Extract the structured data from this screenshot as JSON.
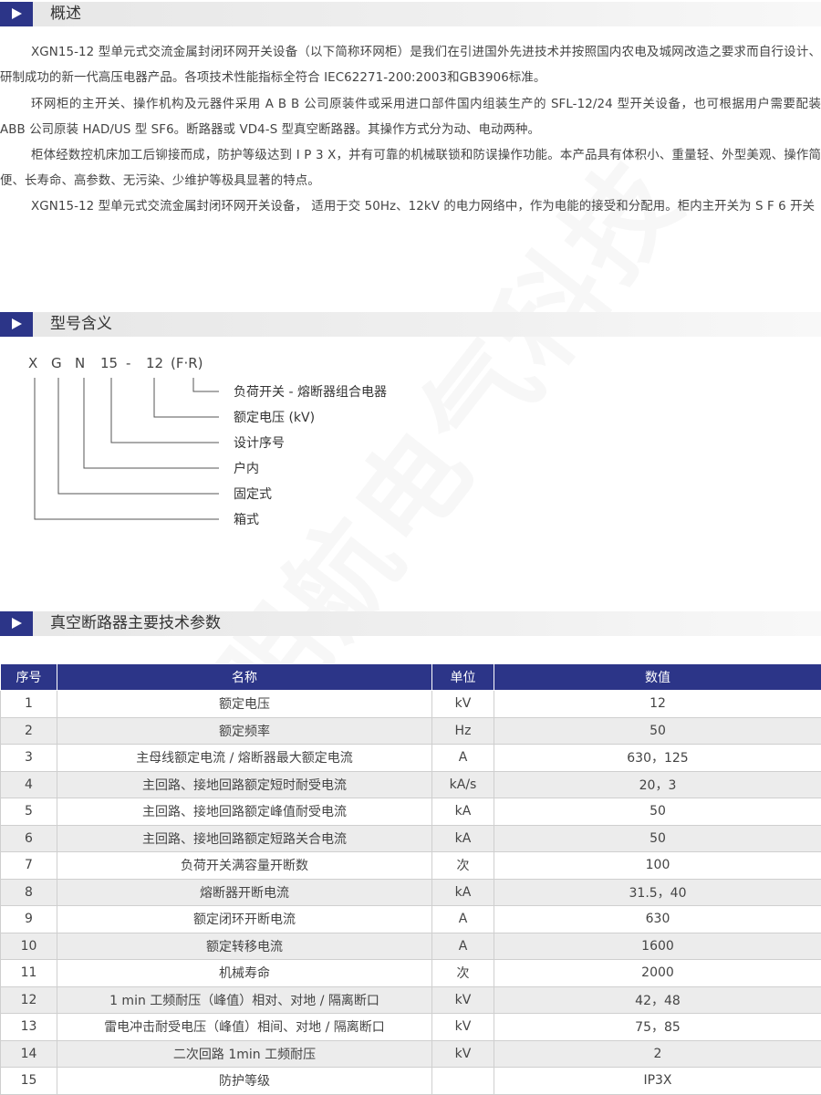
{
  "sections": {
    "overview": "概述",
    "model": "型号含义",
    "params": "真空断路器主要技术参数"
  },
  "overview_paragraphs": [
    "XGN15-12 型单元式交流金属封闭环网开关设备（以下简称环网柜）是我们在引进国外先进技术并按照国内农电及城网改造之要求而自行设计、研制成功的新一代高压电器产品。各项技术性能指标全符合 IEC62271-200:2003和GB3906标准。",
    "环网柜的主开关、操作机构及元器件采用 A B B 公司原装件或采用进口部件国内组装生产的 SFL-12/24 型开关设备，也可根据用户需要配装 ABB 公司原装 HAD/US 型 SF6。断路器或 VD4-S 型真空断路器。其操作方式分为动、电动两种。",
    "柜体经数控机床加工后铆接而成，防护等级达到 I P 3 X，并有可靠的机械联锁和防误操作功能。本产品具有体积小、重量轻、外型美观、操作简便、长寿命、高参数、无污染、少维护等极具显著的特点。",
    "XGN15-12 型单元式交流金属封闭环网开关设备， 适用于交 50Hz、12kV 的电力网络中，作为电能的接受和分配用。柜内主开关为 S F 6 开关"
  ],
  "model_code": {
    "parts": [
      "X",
      "G",
      "N",
      "15",
      "-",
      "12",
      "(F·R)"
    ]
  },
  "model_meanings": [
    "负荷开关 - 熔断器组合电器",
    "额定电压 (kV)",
    "设计序号",
    "户内",
    "固定式",
    "箱式"
  ],
  "table": {
    "headers": [
      "序号",
      "名称",
      "单位",
      "数值"
    ],
    "rows": [
      [
        "1",
        "额定电压",
        "kV",
        "12"
      ],
      [
        "2",
        "额定频率",
        "Hz",
        "50"
      ],
      [
        "3",
        "主母线额定电流 / 熔断器最大额定电流",
        "A",
        "630，125"
      ],
      [
        "4",
        "主回路、接地回路额定短时耐受电流",
        "kA/s",
        "20，3"
      ],
      [
        "5",
        "主回路、接地回路额定峰值耐受电流",
        "kA",
        "50"
      ],
      [
        "6",
        "主回路、接地回路额定短路关合电流",
        "kA",
        "50"
      ],
      [
        "7",
        "负荷开关满容量开断数",
        "次",
        "100"
      ],
      [
        "8",
        "熔断器开断电流",
        "kA",
        "31.5，40"
      ],
      [
        "9",
        "额定闭环开断电流",
        "A",
        "630"
      ],
      [
        "10",
        "额定转移电流",
        "A",
        "1600"
      ],
      [
        "11",
        "机械寿命",
        "次",
        "2000"
      ],
      [
        "12",
        "1 min 工频耐压（峰值）相对、对地 / 隔离断口",
        "kV",
        "42，48"
      ],
      [
        "13",
        "雷电冲击耐受电压（峰值）相间、对地 / 隔离断口",
        "kV",
        "75，85"
      ],
      [
        "14",
        "二次回路 1min 工频耐压",
        "kV",
        "2"
      ],
      [
        "15",
        "防护等级",
        "",
        "IP3X"
      ]
    ]
  },
  "watermark": "明航电气科技",
  "colors": {
    "accent": "#2c3588",
    "row_alt": "#ececec"
  }
}
